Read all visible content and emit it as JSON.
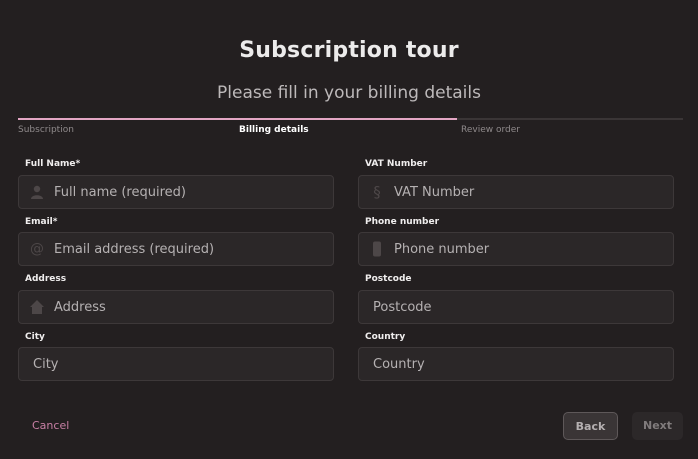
{
  "header": {
    "title": "Subscription tour",
    "subtitle": "Please fill in your billing details"
  },
  "progress": {
    "fraction": 0.66,
    "steps": [
      {
        "label": "Subscription",
        "state": "completed"
      },
      {
        "label": "Billing details",
        "state": "active"
      },
      {
        "label": "Review order",
        "state": "upcoming"
      }
    ]
  },
  "form": {
    "full_name": {
      "label": "Full Name*",
      "placeholder": "Full name (required)",
      "icon": "user-icon"
    },
    "vat": {
      "label": "VAT Number",
      "placeholder": "VAT Number",
      "icon": "section-icon"
    },
    "email": {
      "label": "Email*",
      "placeholder": "Email address (required)",
      "icon": "at-icon"
    },
    "phone": {
      "label": "Phone number",
      "placeholder": "Phone number",
      "icon": "phone-icon"
    },
    "address": {
      "label": "Address",
      "placeholder": "Address",
      "icon": "home-icon"
    },
    "postcode": {
      "label": "Postcode",
      "placeholder": "Postcode"
    },
    "city": {
      "label": "City",
      "placeholder": "City"
    },
    "country": {
      "label": "Country",
      "placeholder": "Country"
    }
  },
  "actions": {
    "cancel": "Cancel",
    "back": "Back",
    "next": "Next"
  },
  "colors": {
    "background": "#231f20",
    "accent": "#e3a6c4",
    "cancel": "#c77fa4"
  }
}
